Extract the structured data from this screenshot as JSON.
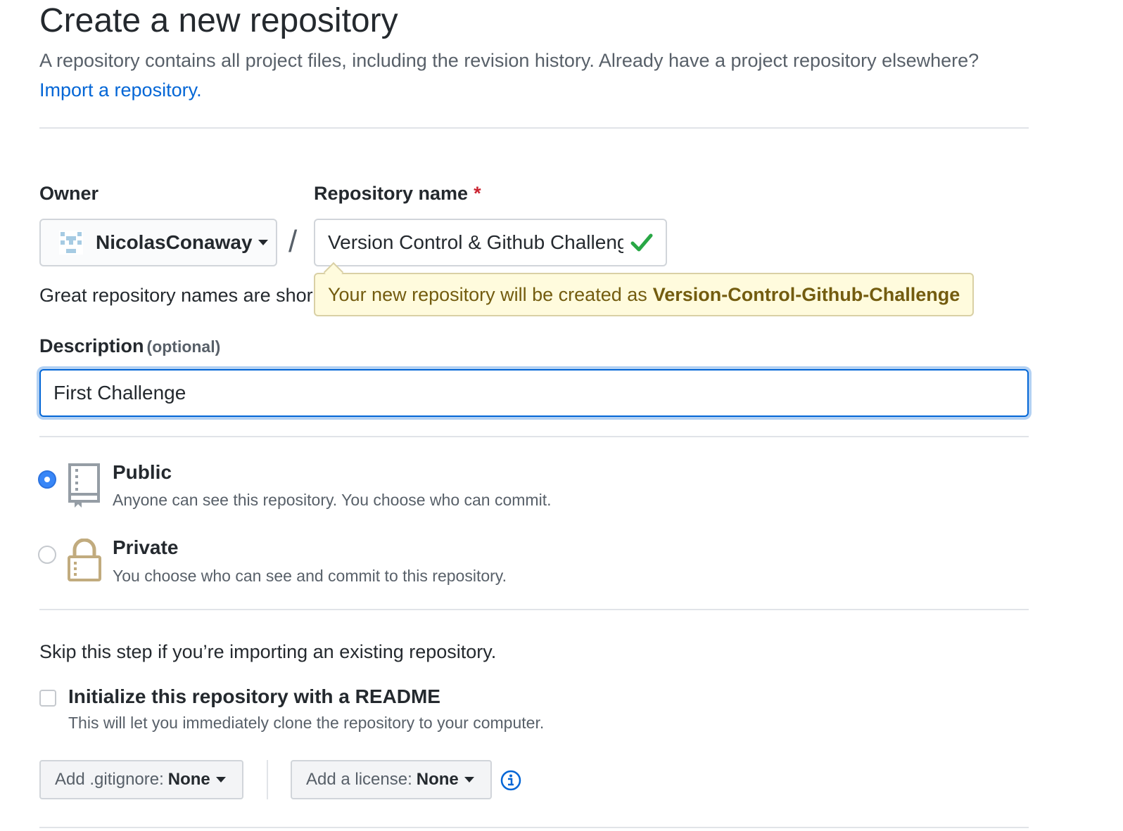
{
  "header": {
    "title": "Create a new repository",
    "intro": "A repository contains all project files, including the revision history. Already have a project repository elsewhere?",
    "import_link": "Import a repository."
  },
  "owner": {
    "label": "Owner",
    "value": "NicolasConaway"
  },
  "separator": "/",
  "repo_name": {
    "label": "Repository name",
    "required_mark": "*",
    "value": "Version Control & Github Challenge",
    "valid": true
  },
  "name_hint": "Great repository names are shor",
  "tooltip": {
    "prefix": "Your new repository will be created as",
    "name": "Version-Control-Github-Challenge"
  },
  "description": {
    "label": "Description",
    "optional": "(optional)",
    "value": "First Challenge"
  },
  "visibility": {
    "selected": "public",
    "public": {
      "title": "Public",
      "desc": "Anyone can see this repository. You choose who can commit."
    },
    "private": {
      "title": "Private",
      "desc": "You choose who can see and commit to this repository."
    }
  },
  "init": {
    "skip_text": "Skip this step if you’re importing an existing repository.",
    "readme_label": "Initialize this repository with a README",
    "readme_desc": "This will let you immediately clone the repository to your computer.",
    "readme_checked": false
  },
  "gitignore": {
    "label": "Add .gitignore:",
    "value": "None"
  },
  "license": {
    "label": "Add a license:",
    "value": "None"
  },
  "icons": {
    "avatar": "identicon-avatar",
    "repo": "repo-book-icon",
    "lock": "lock-icon",
    "check": "check-icon",
    "info": "info-icon"
  },
  "colors": {
    "link": "#0366d6",
    "check": "#28a745",
    "required": "#cb2431",
    "tooltip_bg": "#fffbdd",
    "tooltip_text": "#735c0f",
    "radio_selected": "#3886f7",
    "lock": "#c1ab7e"
  }
}
